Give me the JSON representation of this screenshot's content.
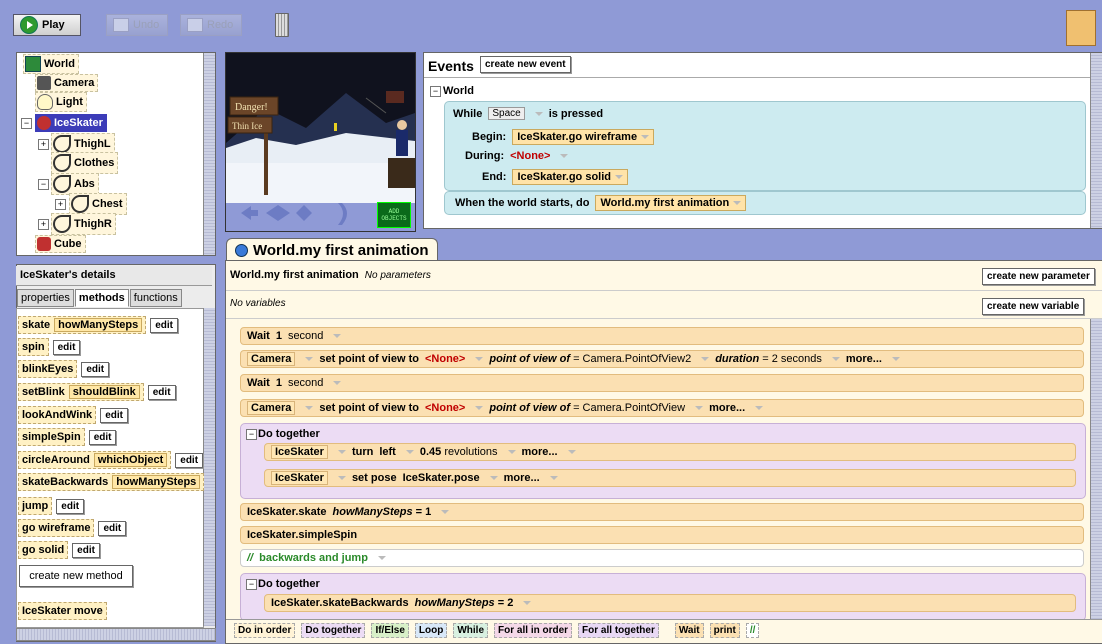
{
  "toolbar": {
    "play": "Play",
    "undo": "Undo",
    "redo": "Redo"
  },
  "object_tree": [
    {
      "label": "World",
      "indent": 0,
      "icon": "world-icon"
    },
    {
      "label": "Camera",
      "indent": 1,
      "icon": "camera-icon"
    },
    {
      "label": "Light",
      "indent": 1,
      "icon": "light-icon"
    },
    {
      "label": "IceSkater",
      "indent": 0,
      "icon": "person-icon",
      "selected": true
    },
    {
      "label": "ThighL",
      "indent": 1,
      "icon": "part-icon"
    },
    {
      "label": "Clothes",
      "indent": 1,
      "icon": "part-icon"
    },
    {
      "label": "Abs",
      "indent": 1,
      "icon": "part-icon"
    },
    {
      "label": "Chest",
      "indent": 2,
      "icon": "part-icon"
    },
    {
      "label": "ThighR",
      "indent": 1,
      "icon": "part-icon"
    },
    {
      "label": "Cube",
      "indent": 0,
      "icon": "cube-icon"
    }
  ],
  "details": {
    "title": "IceSkater's details",
    "tabs": [
      "properties",
      "methods",
      "functions"
    ],
    "active_tab": "methods",
    "methods": [
      {
        "name": "skate",
        "param": "howManySteps",
        "edit": "edit"
      },
      {
        "name": "spin",
        "param": "",
        "edit": "edit"
      },
      {
        "name": "blinkEyes",
        "param": "",
        "edit": "edit"
      },
      {
        "name": "setBlink",
        "param": "shouldBlink",
        "edit": "edit"
      },
      {
        "name": "lookAndWink",
        "param": "",
        "edit": "edit"
      },
      {
        "name": "simpleSpin",
        "param": "",
        "edit": "edit"
      },
      {
        "name": "circleAround",
        "param": "whichObject",
        "edit": "edit"
      },
      {
        "name": "skateBackwards",
        "param": "howManySteps",
        "edit": ""
      },
      {
        "name": "jump",
        "param": "",
        "edit": "edit"
      },
      {
        "name": "go wireframe",
        "param": "",
        "edit": "edit"
      },
      {
        "name": "go solid",
        "param": "",
        "edit": "edit"
      }
    ],
    "create_new_method": "create new method",
    "builtin": {
      "name": "IceSkater",
      "action": "move"
    }
  },
  "scene": {
    "sign_line1": "Danger!",
    "sign_line2": "Thin Ice",
    "add_objects": "ADD OBJECTS"
  },
  "events": {
    "title": "Events",
    "create_button": "create new event",
    "world_label": "World",
    "while": {
      "prefix": "While",
      "key": "Space",
      "suffix": "is pressed",
      "begin_label": "Begin:",
      "begin_value": "IceSkater.go wireframe",
      "during_label": "During:",
      "during_value": "<None>",
      "end_label": "End:",
      "end_value": "IceSkater.go solid"
    },
    "when_start": {
      "label": "When the world starts, do",
      "value": "World.my first animation"
    }
  },
  "editor": {
    "tab_title": "World.my first animation",
    "method_name": "World.my first animation",
    "no_params": "No parameters",
    "no_vars": "No variables",
    "create_param": "create new parameter",
    "create_var": "create new variable",
    "lines": {
      "wait1": {
        "kw": "Wait",
        "val": "1",
        "unit": "second"
      },
      "cam1": {
        "obj": "Camera",
        "method": "set point of view to",
        "target": "<None>",
        "arg_label": "point of view of",
        "arg_value": "= Camera.PointOfView2",
        "dur_label": "duration",
        "dur_value": "= 2 seconds",
        "more": "more..."
      },
      "wait2": {
        "kw": "Wait",
        "val": "1",
        "unit": "second"
      },
      "cam2": {
        "obj": "Camera",
        "method": "set point of view to",
        "target": "<None>",
        "arg_label": "point of view of",
        "arg_value": "= Camera.PointOfView",
        "more": "more..."
      },
      "dotogether1": "Do together",
      "turn": {
        "obj": "IceSkater",
        "method": "turn",
        "dir": "left",
        "amount": "0.45",
        "unit": "revolutions",
        "more": "more..."
      },
      "pose": {
        "obj": "IceSkater",
        "method": "set pose",
        "value": "IceSkater.pose",
        "more": "more..."
      },
      "skate": {
        "call": "IceSkater.skate",
        "param": "howManySteps",
        "value": "= 1"
      },
      "simplespin": "IceSkater.simpleSpin",
      "comment": {
        "slashes": "//",
        "text": "backwards and jump"
      },
      "dotogether2": "Do together",
      "skatebw": {
        "call": "IceSkater.skateBackwards",
        "param": "howManySteps",
        "value": "= 2"
      }
    },
    "bottom": [
      "Do in order",
      "Do together",
      "If/Else",
      "Loop",
      "While",
      "For all in order",
      "For all together",
      "Wait",
      "print",
      "//"
    ]
  },
  "colors": {
    "background": "#8f9ad6",
    "editor_bg": "#fff9e6",
    "statement": "#fbe0b2",
    "do_together": "#ecdcf4",
    "event": "#cdebf0"
  }
}
